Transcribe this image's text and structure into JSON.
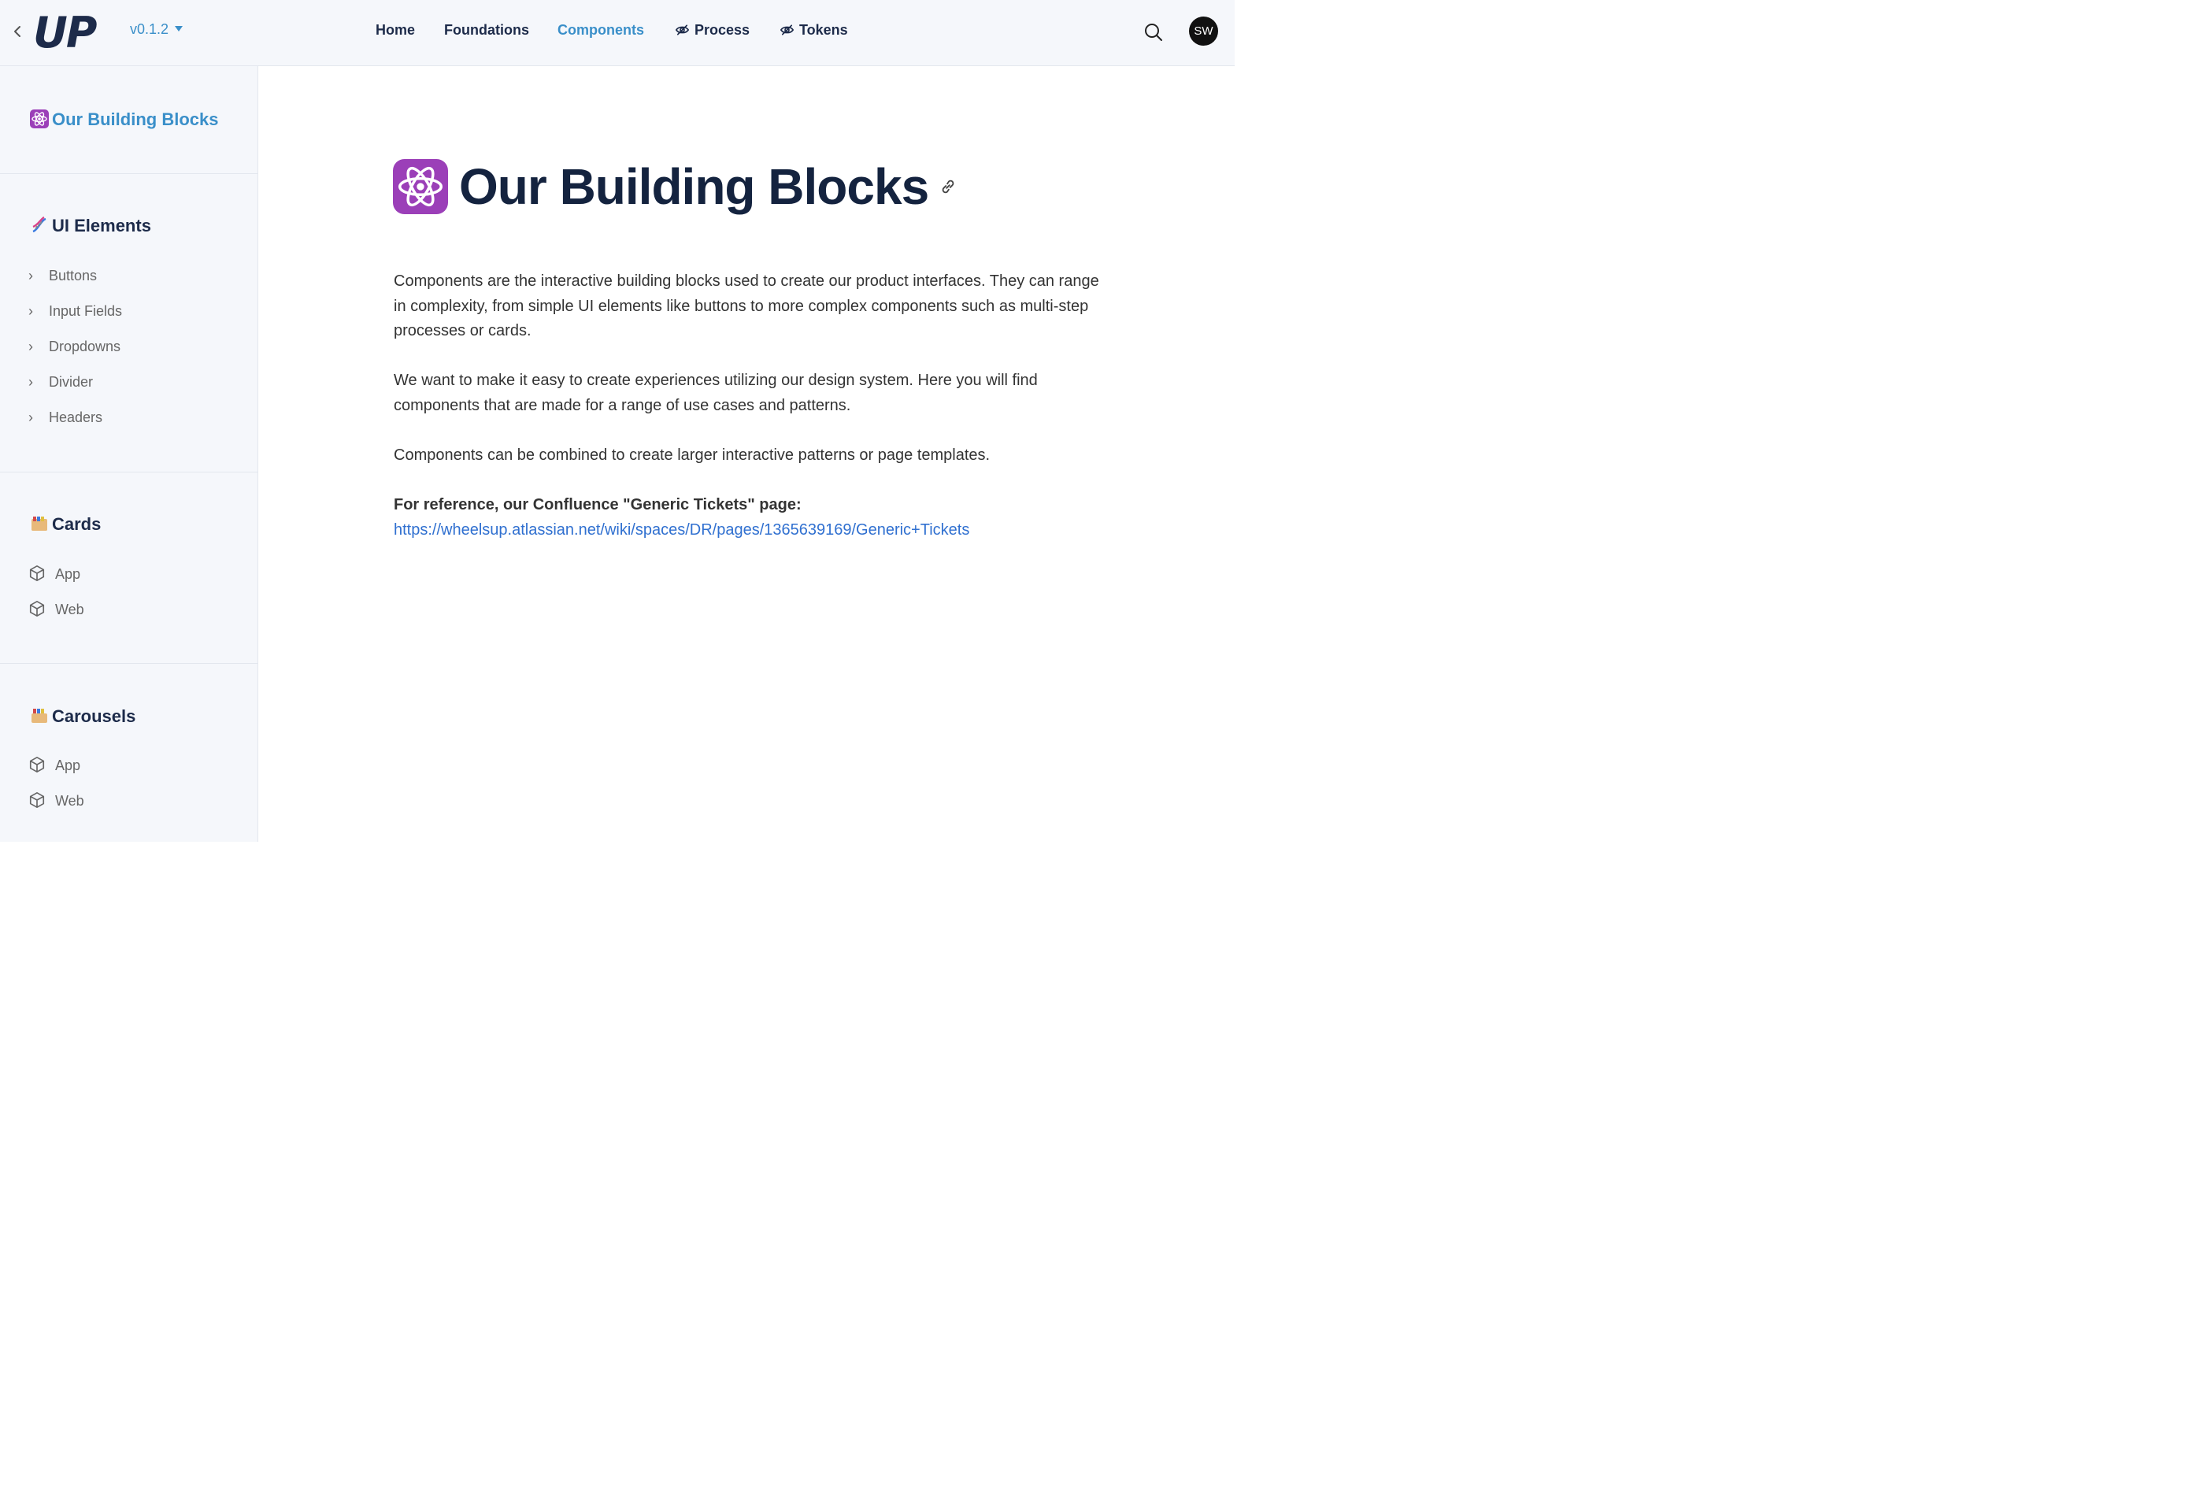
{
  "header": {
    "logo": "UP",
    "version": "v0.1.2",
    "nav": [
      "Home",
      "Foundations",
      "Components",
      "Process",
      "Tokens"
    ],
    "active_nav": "Components",
    "avatar_initials": "SW"
  },
  "sidebar": {
    "top": "Our Building Blocks",
    "sections": [
      {
        "title": "UI Elements",
        "items": [
          "Buttons",
          "Input Fields",
          "Dropdowns",
          "Divider",
          "Headers"
        ]
      },
      {
        "title": "Cards",
        "items": [
          "App",
          "Web"
        ]
      },
      {
        "title": "Carousels",
        "items": [
          "App",
          "Web"
        ]
      }
    ]
  },
  "main": {
    "title": "Our Building Blocks",
    "paragraphs": [
      "Components are the interactive building blocks used to create our product interfaces. They can range in complexity, from simple UI elements like buttons to more complex components such as multi-step processes or cards.",
      "We want to make it easy to create experiences utilizing our design system. Here you will find components that are made for a range of use cases and patterns.",
      "Components can be combined to create larger interactive patterns or page templates."
    ],
    "reference_label": "For reference, our Confluence \"Generic Tickets\" page:",
    "reference_url": "https://wheelsup.atlassian.net/wiki/spaces/DR/pages/1365639169/Generic+Tickets"
  },
  "colors": {
    "accent": "#3a8fc9",
    "heading": "#14233f",
    "link": "#3070d0"
  }
}
